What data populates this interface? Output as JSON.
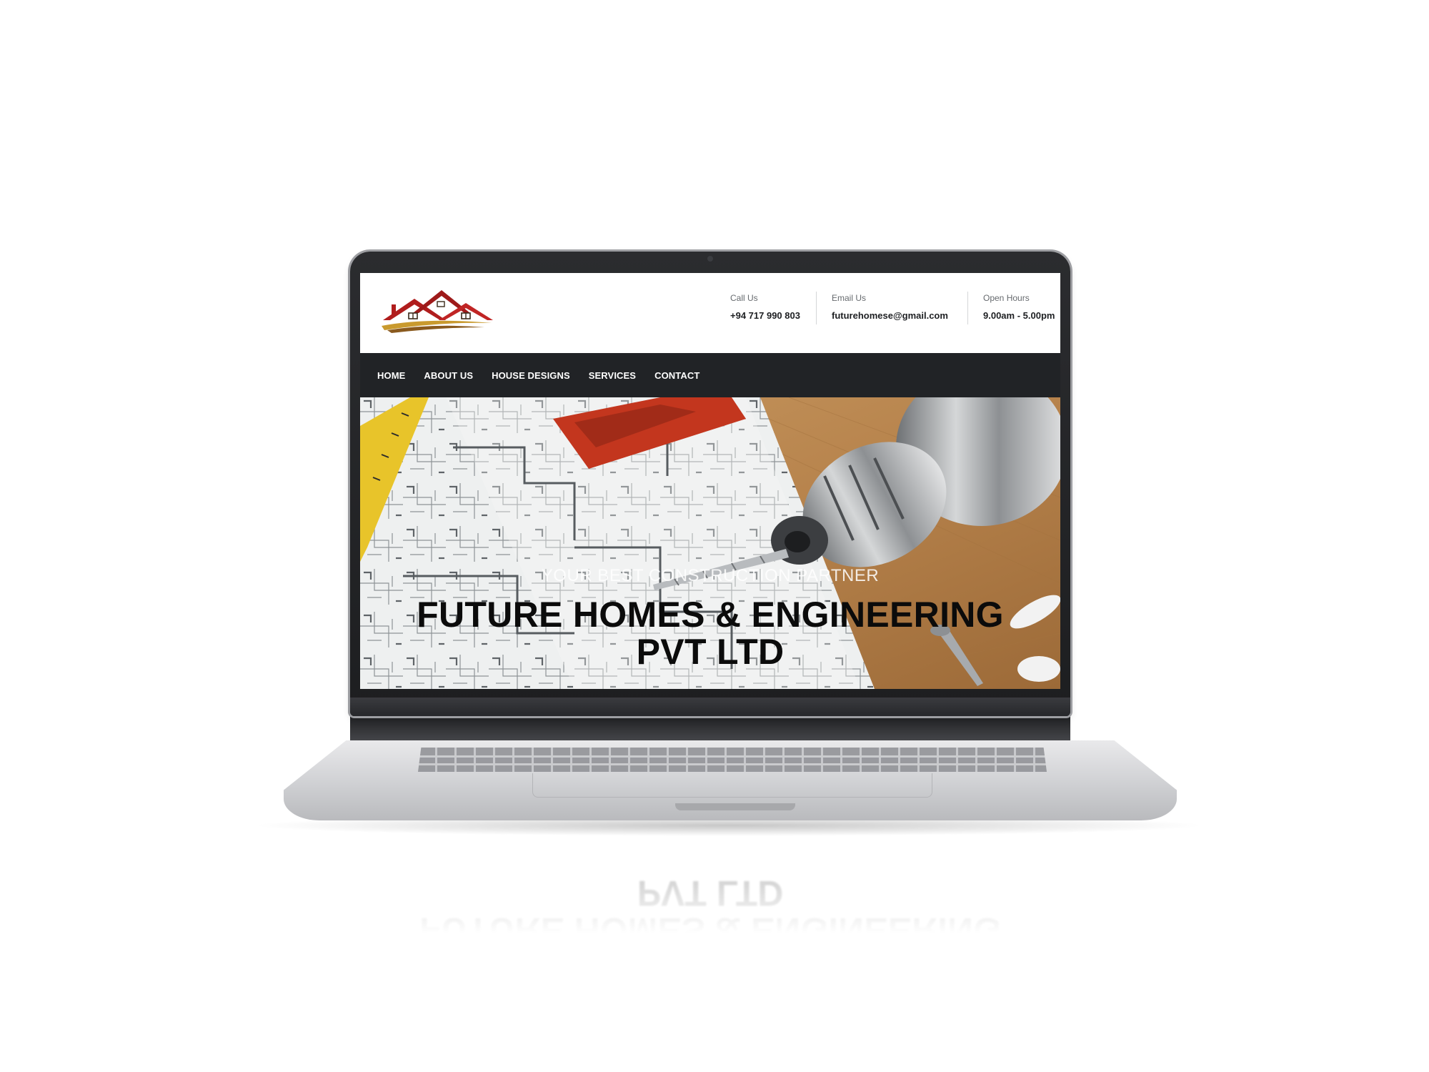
{
  "site": {
    "logo_icon": "house-roof-logo-icon",
    "accent_colors": {
      "roof_red": "#b01d1d",
      "roof_gold": "#c99a2e",
      "nav_bg": "#212326"
    }
  },
  "contact": {
    "call": {
      "label": "Call Us",
      "value": "+94 717 990 803"
    },
    "email": {
      "label": "Email Us",
      "value": "futurehomese@gmail.com"
    },
    "hours": {
      "label": "Open Hours",
      "value": "9.00am - 5.00pm"
    }
  },
  "nav": {
    "items": [
      {
        "label": "HOME"
      },
      {
        "label": "ABOUT US"
      },
      {
        "label": "HOUSE DESIGNS"
      },
      {
        "label": "SERVICES"
      },
      {
        "label": "CONTACT"
      }
    ]
  },
  "hero": {
    "tagline": "YOUR BEST CONSTRUCTION PARTNER",
    "title_line1": "FUTURE HOMES & ENGINEERING",
    "title_line2": "PVT LTD",
    "background_icon": "blueprint-drill-photo"
  }
}
